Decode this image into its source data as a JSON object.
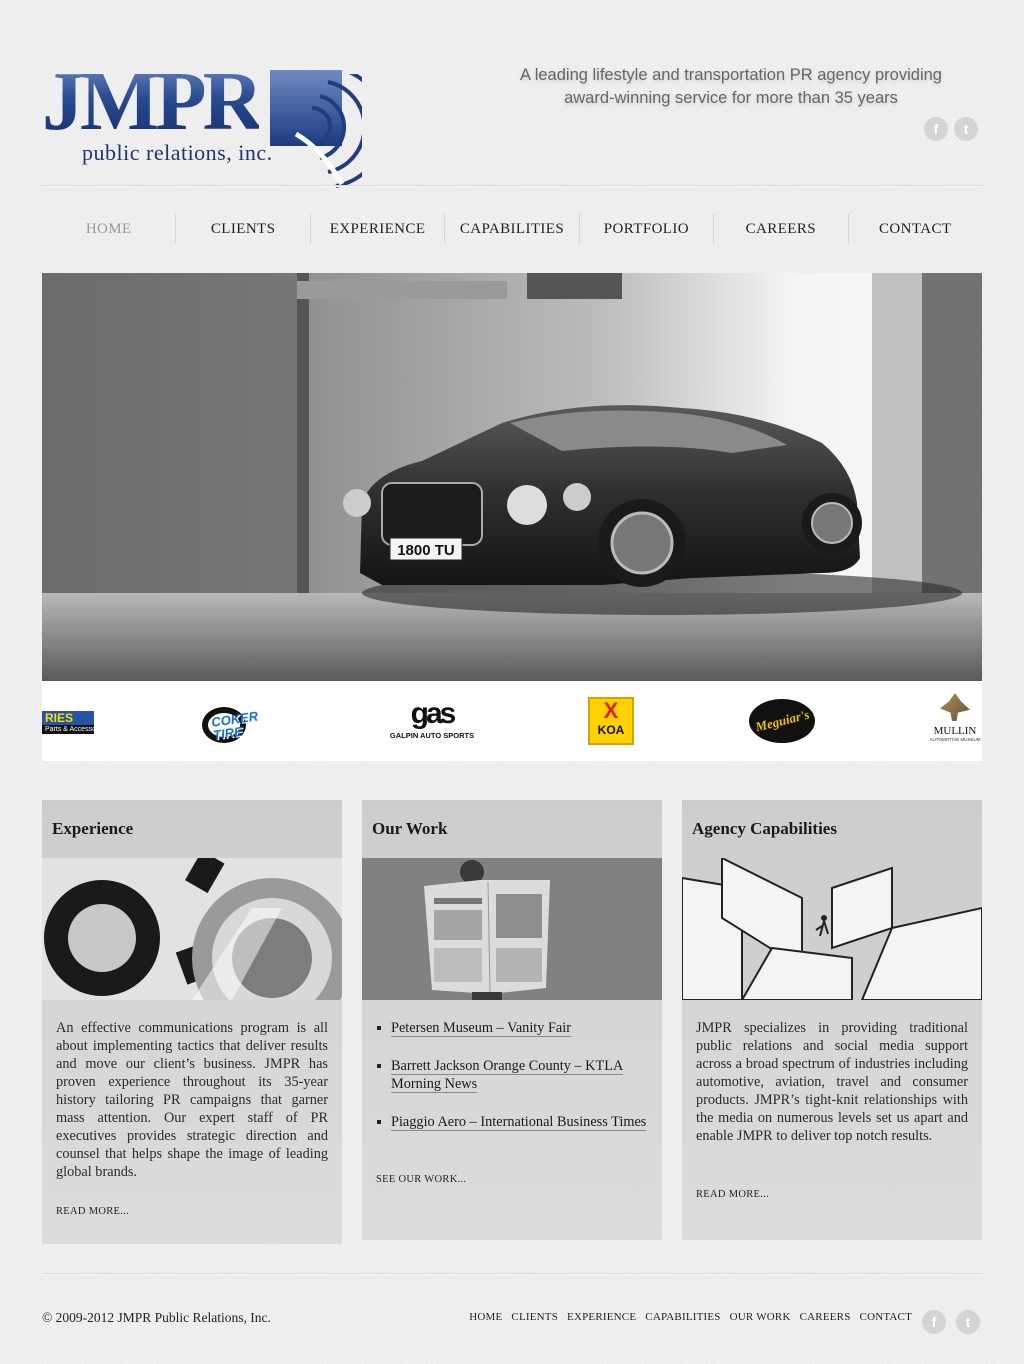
{
  "brand": {
    "logo_main": "JMPR",
    "logo_sub": "public relations, inc.",
    "tagline": "A leading lifestyle and transportation PR agency providing award-winning service for more than 35 years"
  },
  "social": {
    "facebook": "f",
    "twitter": "t"
  },
  "nav": {
    "items": [
      "HOME",
      "CLIENTS",
      "EXPERIENCE",
      "CAPABILITIES",
      "PORTFOLIO",
      "CAREERS",
      "CONTACT"
    ],
    "active": "HOME"
  },
  "hero": {
    "plate": "1800 TU"
  },
  "client_logos": {
    "left_partial": "RIES",
    "left_partial_sub": "Parts & Accessories",
    "coker": "COKER TIRE",
    "galpin": "GALPIN AUTO SPORTS",
    "koa": "KOA",
    "meguiars": "Meguiar's",
    "mullin": "MULLIN",
    "mullin_sub": "AUTOMOTIVE MUSEUM"
  },
  "boxes": {
    "experience": {
      "title": "Experience",
      "text": "An effective communications program is all about implementing tactics that deliver results and move our client’s business. JMPR has proven experience throughout its 35-year history tailoring PR campaigns that garner mass attention. Our expert staff of PR executives provides strategic direction and counsel that helps shape the image of leading global brands.",
      "more": "READ MORE..."
    },
    "work": {
      "title": "Our Work",
      "items": [
        "Petersen Museum – Vanity Fair",
        "Barrett Jackson Orange County – KTLA Morning News",
        "Piaggio Aero – International Business Times"
      ],
      "more": "SEE OUR WORK..."
    },
    "capabilities": {
      "title": "Agency Capabilities",
      "text": "JMPR specializes in providing traditional public relations and social media support across a broad spectrum of industries including automotive, aviation, travel and consumer products. JMPR’s tight-knit relationships with the media on numerous levels set us apart and enable JMPR to deliver top notch results.",
      "more": "READ MORE..."
    }
  },
  "footer": {
    "copyright": "© 2009-2012 JMPR Public Relations, Inc.",
    "links": [
      "HOME",
      "CLIENTS",
      "EXPERIENCE",
      "CAPABILITIES",
      "OUR WORK",
      "CAREERS",
      "CONTACT"
    ]
  },
  "colors": {
    "brand_blue": "#1e3e80",
    "background": "#ececec",
    "box": "#d2d2d2"
  }
}
